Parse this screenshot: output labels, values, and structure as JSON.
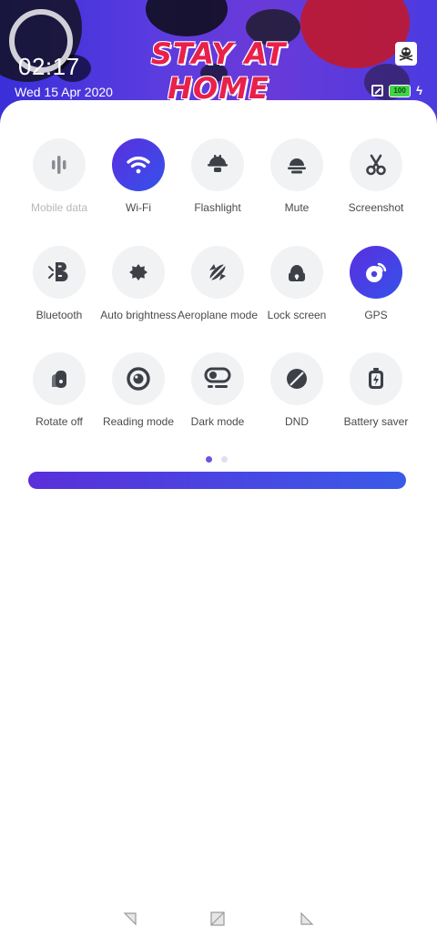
{
  "status": {
    "time": "02:17",
    "date": "Wed  15 Apr 2020",
    "battery_level": "100",
    "battery_percent": 100
  },
  "wallpaper": {
    "headline": "STAY AT HOME"
  },
  "tiles": [
    {
      "id": "mobile-data",
      "label": "Mobile data",
      "icon": "mobile-data-icon",
      "state": "disabled"
    },
    {
      "id": "wifi",
      "label": "Wi-Fi",
      "icon": "wifi-icon",
      "state": "on"
    },
    {
      "id": "flashlight",
      "label": "Flashlight",
      "icon": "flashlight-icon",
      "state": "off"
    },
    {
      "id": "mute",
      "label": "Mute",
      "icon": "bell-mute-icon",
      "state": "off"
    },
    {
      "id": "screenshot",
      "label": "Screenshot",
      "icon": "scissors-icon",
      "state": "off"
    },
    {
      "id": "bluetooth",
      "label": "Bluetooth",
      "icon": "bluetooth-icon",
      "state": "off"
    },
    {
      "id": "auto-brightness",
      "label": "Auto brightness",
      "icon": "brightness-icon",
      "state": "off"
    },
    {
      "id": "aeroplane-mode",
      "label": "Aeroplane mode",
      "icon": "airplane-icon",
      "state": "off"
    },
    {
      "id": "lock-screen",
      "label": "Lock screen",
      "icon": "lock-icon",
      "state": "off"
    },
    {
      "id": "gps",
      "label": "GPS",
      "icon": "gps-icon",
      "state": "on"
    },
    {
      "id": "rotate-off",
      "label": "Rotate off",
      "icon": "rotate-lock-icon",
      "state": "off"
    },
    {
      "id": "reading-mode",
      "label": "Reading mode",
      "icon": "eye-icon",
      "state": "off"
    },
    {
      "id": "dark-mode",
      "label": "Dark mode",
      "icon": "dark-mode-icon",
      "state": "off"
    },
    {
      "id": "dnd",
      "label": "DND",
      "icon": "dnd-icon",
      "state": "off"
    },
    {
      "id": "battery-saver",
      "label": "Battery saver",
      "icon": "battery-saver-icon",
      "state": "off"
    }
  ],
  "pager": {
    "pages": 2,
    "current": 1
  },
  "brightness": {
    "level": 1.0
  },
  "colors": {
    "accent_start": "#5a2ee0",
    "accent_end": "#3552ea",
    "tile_bg": "#f1f2f4",
    "icon_dark": "#3e4048"
  },
  "nav": {
    "back": "back-icon",
    "home": "home-icon",
    "recents": "recents-icon"
  }
}
